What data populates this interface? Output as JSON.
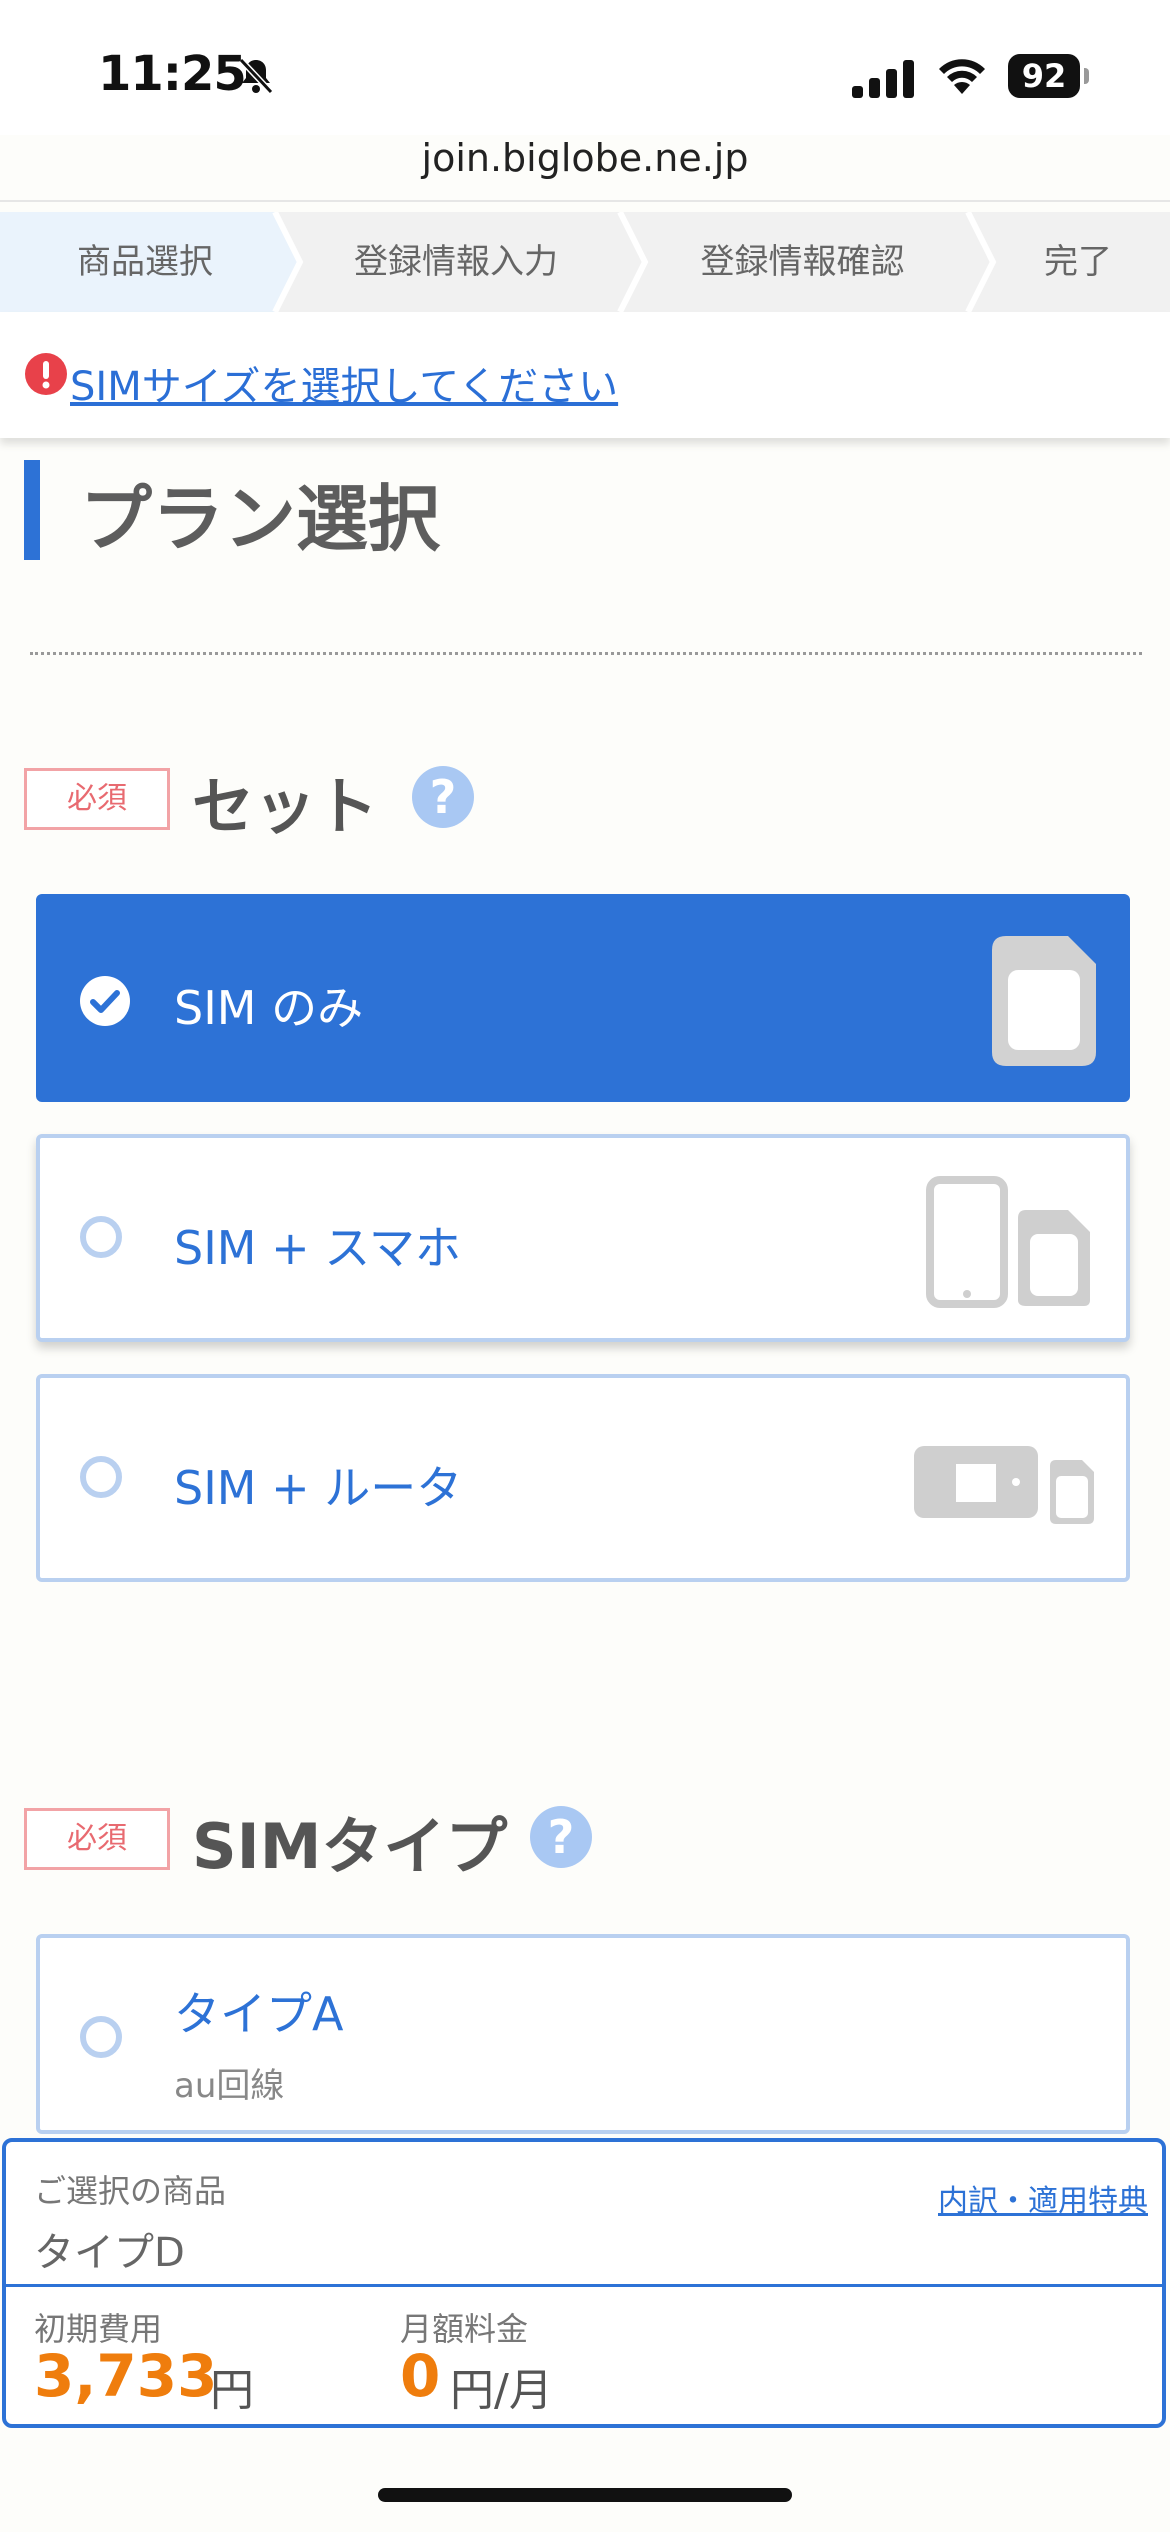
{
  "status_bar": {
    "time": "11:25",
    "battery": "92"
  },
  "browser": {
    "url": "join.biglobe.ne.jp"
  },
  "steps": [
    "商品選択",
    "登録情報入力",
    "登録情報確認",
    "完了"
  ],
  "alert": {
    "message": "SIMサイズを選択してください",
    "color": "#e8414a"
  },
  "plan": {
    "title": "プラン選択"
  },
  "set_section": {
    "required": "必須",
    "title": "セット",
    "help": "?",
    "options": [
      {
        "label": "SIM のみ",
        "selected": true,
        "icon": "sim-card-icon"
      },
      {
        "label": "SIM + スマホ",
        "selected": false,
        "icon": "phone-sim-icon"
      },
      {
        "label": "SIM + ルータ",
        "selected": false,
        "icon": "router-sim-icon"
      }
    ]
  },
  "sim_type_section": {
    "required": "必須",
    "title": "SIMタイプ",
    "help": "?",
    "options": [
      {
        "label": "タイプA",
        "sub": "au回線",
        "selected": false
      }
    ]
  },
  "summary": {
    "selected_label": "ご選択の商品",
    "selected_value": "タイプD",
    "details_link": "内訳・適用特典",
    "initial_label": "初期費用",
    "initial_price": "3,733",
    "initial_unit": "円",
    "monthly_label": "月額料金",
    "monthly_price": "0",
    "monthly_unit": "円/月"
  },
  "colors": {
    "accent": "#2d72d6",
    "price": "#ef7d0d",
    "required": "#e86a70"
  }
}
